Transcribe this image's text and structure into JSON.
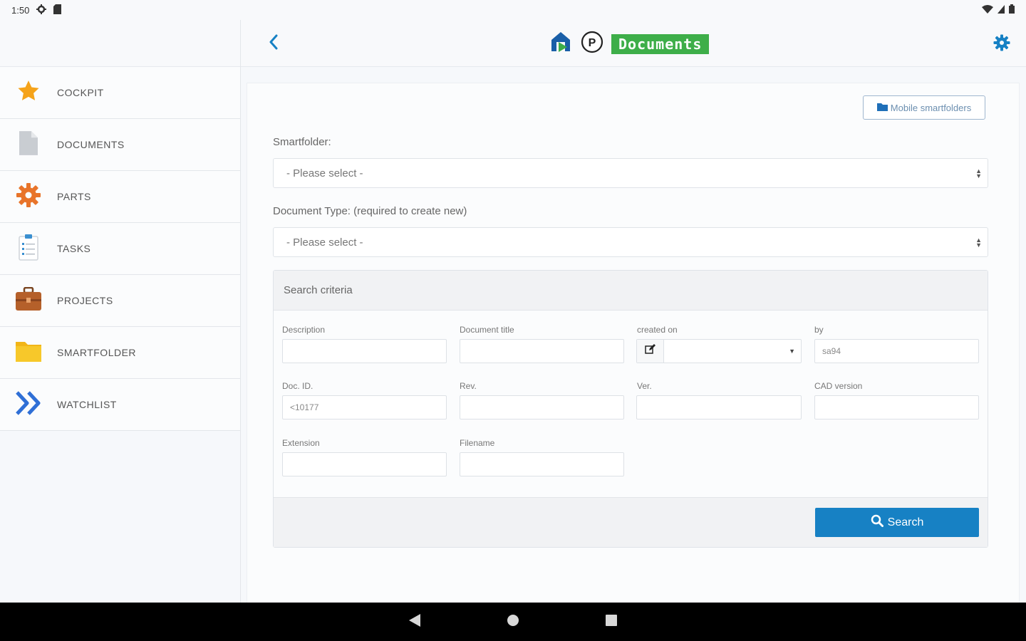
{
  "status_bar": {
    "time": "1:50"
  },
  "header": {
    "title": "Documents"
  },
  "sidebar": {
    "items": [
      {
        "label": "COCKPIT",
        "icon": "star-icon",
        "color": "#f5a31a"
      },
      {
        "label": "DOCUMENTS",
        "icon": "document-icon",
        "color": "#bfc4ca"
      },
      {
        "label": "PARTS",
        "icon": "gear-icon",
        "color": "#e8742a"
      },
      {
        "label": "TASKS",
        "icon": "clipboard-icon",
        "color": "#3a8fd0"
      },
      {
        "label": "PROJECTS",
        "icon": "briefcase-icon",
        "color": "#b5602a"
      },
      {
        "label": "SMARTFOLDER",
        "icon": "folder-icon",
        "color": "#f7c21d"
      },
      {
        "label": "WATCHLIST",
        "icon": "double-chevron-icon",
        "color": "#2f6fd6"
      }
    ]
  },
  "main": {
    "mobile_smartfolders_label": "Mobile smartfolders",
    "smartfolder_label": "Smartfolder:",
    "smartfolder_value": "- Please select -",
    "doctype_label": "Document Type: (required to create new)",
    "doctype_value": "- Please select -",
    "criteria": {
      "title": "Search criteria",
      "fields": {
        "description": {
          "label": "Description",
          "value": ""
        },
        "document_title": {
          "label": "Document title",
          "value": ""
        },
        "created_on": {
          "label": "created on",
          "value": ""
        },
        "by": {
          "label": "by",
          "value": "sa94"
        },
        "doc_id": {
          "label": "Doc. ID.",
          "value": "<10177"
        },
        "rev": {
          "label": "Rev.",
          "value": ""
        },
        "ver": {
          "label": "Ver.",
          "value": ""
        },
        "cad_version": {
          "label": "CAD version",
          "value": ""
        },
        "extension": {
          "label": "Extension",
          "value": ""
        },
        "filename": {
          "label": "Filename",
          "value": ""
        }
      },
      "search_label": "Search"
    }
  },
  "colors": {
    "brand_green": "#3eae49",
    "primary_blue": "#1781c4"
  }
}
